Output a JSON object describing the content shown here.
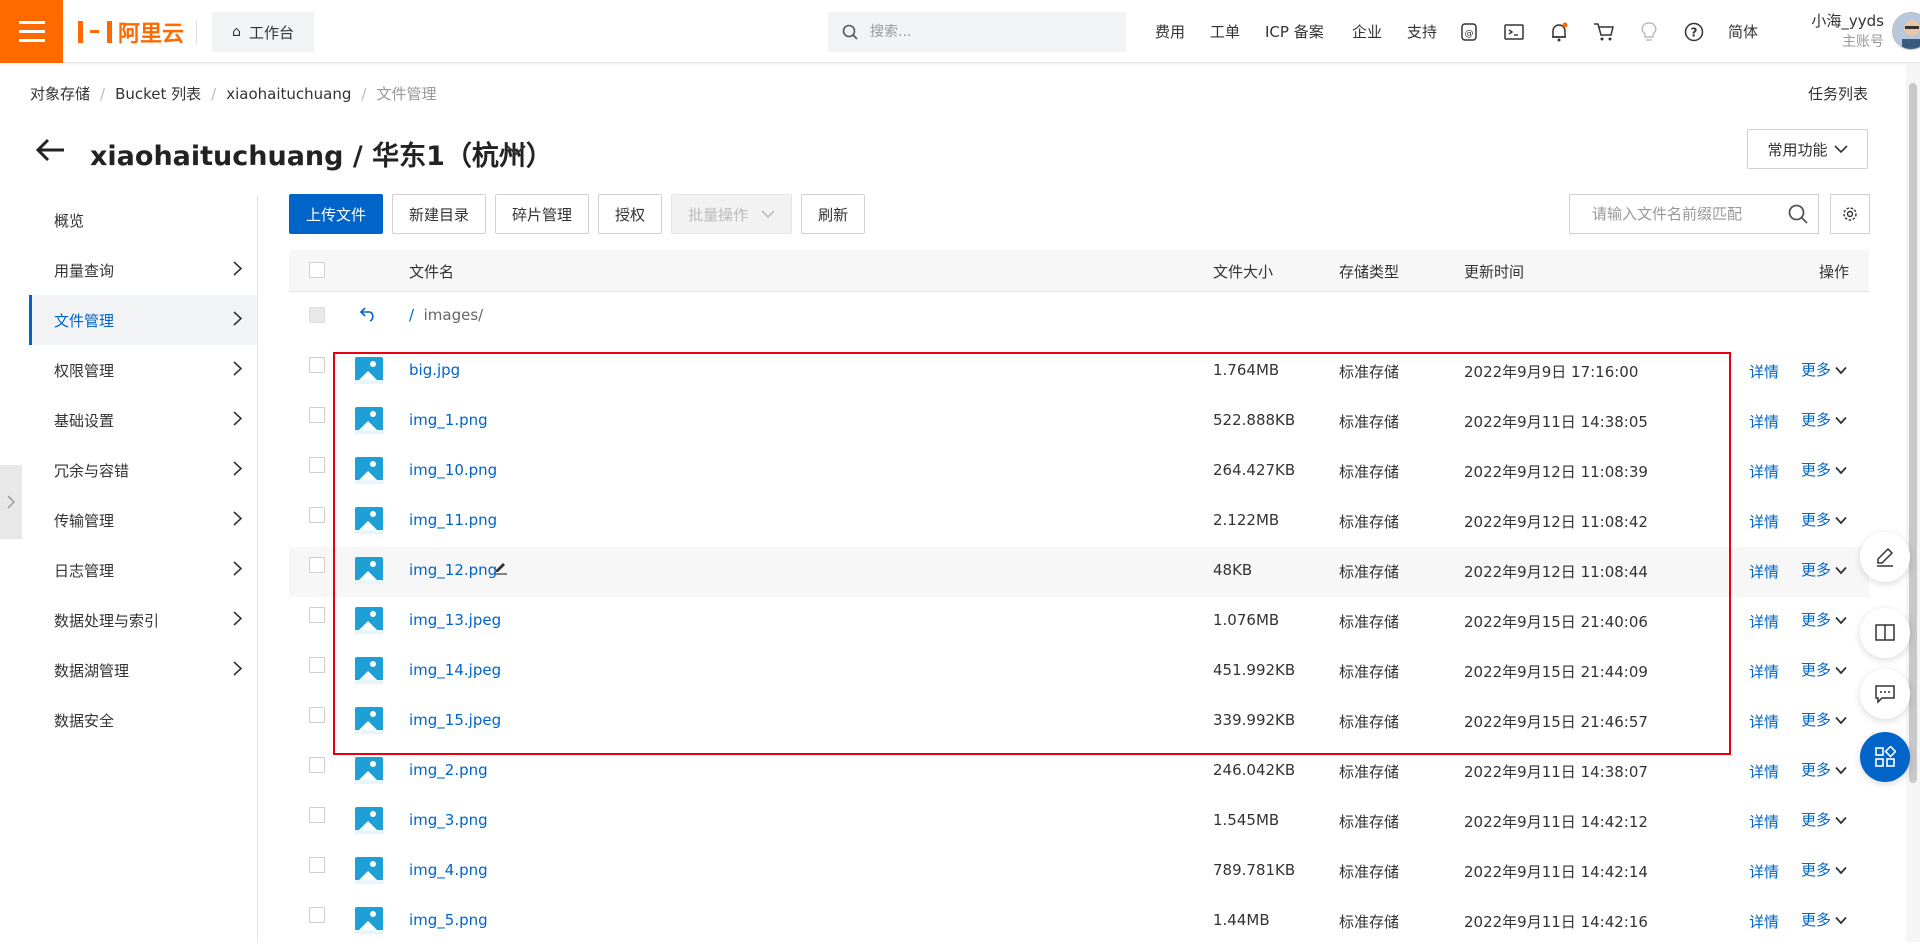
{
  "topbar": {
    "logo_text": "阿里云",
    "workbench": "工作台",
    "search_placeholder": "搜索...",
    "nav": [
      "费用",
      "工单",
      "ICP 备案",
      "企业",
      "支持"
    ],
    "lang": "简体",
    "user_name": "小海_yyds",
    "user_role": "主账号"
  },
  "breadcrumb": {
    "items": [
      "对象存储",
      "Bucket 列表",
      "xiaohaituchuang",
      "文件管理"
    ]
  },
  "task_list": "任务列表",
  "title": "xiaohaituchuang / 华东1（杭州）",
  "common_functions": "常用功能",
  "sidebar": {
    "items": [
      {
        "label": "概览",
        "chevron": false
      },
      {
        "label": "用量查询",
        "chevron": true
      },
      {
        "label": "文件管理",
        "chevron": true,
        "active": true
      },
      {
        "label": "权限管理",
        "chevron": true
      },
      {
        "label": "基础设置",
        "chevron": true
      },
      {
        "label": "冗余与容错",
        "chevron": true
      },
      {
        "label": "传输管理",
        "chevron": true
      },
      {
        "label": "日志管理",
        "chevron": true
      },
      {
        "label": "数据处理与索引",
        "chevron": true
      },
      {
        "label": "数据湖管理",
        "chevron": true
      },
      {
        "label": "数据安全",
        "chevron": false
      }
    ]
  },
  "toolbar": {
    "upload": "上传文件",
    "new_dir": "新建目录",
    "fragments": "碎片管理",
    "authorize": "授权",
    "batch": "批量操作",
    "refresh": "刷新",
    "search_placeholder": "请输入文件名前缀匹配"
  },
  "table": {
    "headers": {
      "name": "文件名",
      "size": "文件大小",
      "type": "存储类型",
      "time": "更新时间",
      "ops": "操作"
    },
    "path": "/ images/",
    "detail_label": "详情",
    "more_label": "更多",
    "rows": [
      {
        "name": "big.jpg",
        "size": "1.764MB",
        "type": "标准存储",
        "time": "2022年9月9日 17:16:00"
      },
      {
        "name": "img_1.png",
        "size": "522.888KB",
        "type": "标准存储",
        "time": "2022年9月11日 14:38:05"
      },
      {
        "name": "img_10.png",
        "size": "264.427KB",
        "type": "标准存储",
        "time": "2022年9月12日 11:08:39"
      },
      {
        "name": "img_11.png",
        "size": "2.122MB",
        "type": "标准存储",
        "time": "2022年9月12日 11:08:42"
      },
      {
        "name": "img_12.png",
        "size": "48KB",
        "type": "标准存储",
        "time": "2022年9月12日 11:08:44",
        "hover": true
      },
      {
        "name": "img_13.jpeg",
        "size": "1.076MB",
        "type": "标准存储",
        "time": "2022年9月15日 21:40:06"
      },
      {
        "name": "img_14.jpeg",
        "size": "451.992KB",
        "type": "标准存储",
        "time": "2022年9月15日 21:44:09"
      },
      {
        "name": "img_15.jpeg",
        "size": "339.992KB",
        "type": "标准存储",
        "time": "2022年9月15日 21:46:57"
      },
      {
        "name": "img_2.png",
        "size": "246.042KB",
        "type": "标准存储",
        "time": "2022年9月11日 14:38:07"
      },
      {
        "name": "img_3.png",
        "size": "1.545MB",
        "type": "标准存储",
        "time": "2022年9月11日 14:42:12"
      },
      {
        "name": "img_4.png",
        "size": "789.781KB",
        "type": "标准存储",
        "time": "2022年9月11日 14:42:14"
      },
      {
        "name": "img_5.png",
        "size": "1.44MB",
        "type": "标准存储",
        "time": "2022年9月11日 14:42:16"
      }
    ]
  },
  "colors": {
    "brand": "#ff6a00",
    "primary": "#0064c8",
    "highlight_box": "#e60012"
  }
}
